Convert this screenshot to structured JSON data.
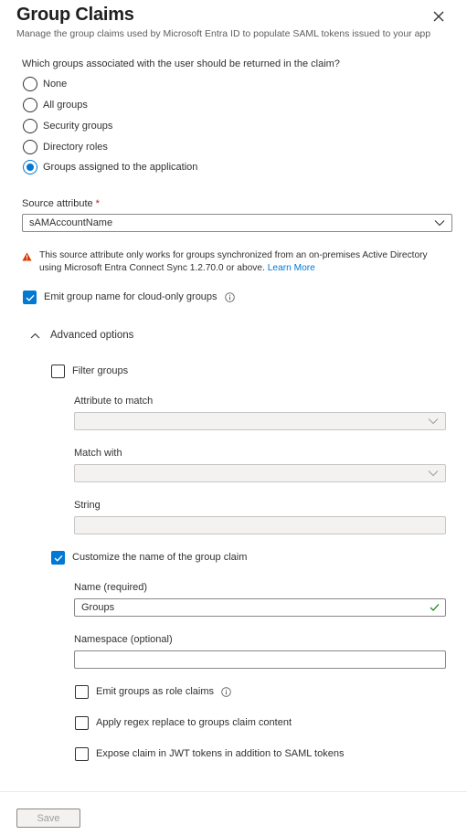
{
  "panel": {
    "title": "Group Claims",
    "subtitle": "Manage the group claims used by Microsoft Entra ID to populate SAML tokens issued to your app"
  },
  "question": "Which groups associated with the user should be returned in the claim?",
  "radio_options": [
    {
      "label": "None",
      "selected": false
    },
    {
      "label": "All groups",
      "selected": false
    },
    {
      "label": "Security groups",
      "selected": false
    },
    {
      "label": "Directory roles",
      "selected": false
    },
    {
      "label": "Groups assigned to the application",
      "selected": true
    }
  ],
  "source_attribute": {
    "label": "Source attribute",
    "required_marker": "*",
    "value": "sAMAccountName"
  },
  "warning": {
    "text": "This source attribute only works for groups synchronized from an on-premises Active Directory using Microsoft Entra Connect Sync 1.2.70.0 or above.",
    "link": "Learn More"
  },
  "emit_cloud_only": {
    "label": "Emit group name for cloud-only groups",
    "checked": true
  },
  "advanced": {
    "label": "Advanced options",
    "filter_groups": {
      "label": "Filter groups",
      "checked": false
    },
    "attribute_to_match": {
      "label": "Attribute to match",
      "value": ""
    },
    "match_with": {
      "label": "Match with",
      "value": ""
    },
    "string": {
      "label": "String",
      "value": ""
    },
    "customize_name": {
      "label": "Customize the name of the group claim",
      "checked": true
    },
    "name": {
      "label": "Name (required)",
      "value": "Groups"
    },
    "namespace": {
      "label": "Namespace (optional)",
      "value": ""
    },
    "emit_role_claims": {
      "label": "Emit groups as role claims",
      "checked": false
    },
    "regex_replace": {
      "label": "Apply regex replace to groups claim content",
      "checked": false
    },
    "expose_jwt": {
      "label": "Expose claim in JWT tokens in addition to SAML tokens",
      "checked": false
    }
  },
  "footer": {
    "save_label": "Save"
  },
  "colors": {
    "accent": "#0078d4",
    "warning": "#d83b01",
    "success": "#107c10",
    "required": "#a4262c"
  },
  "icons": {
    "close": "close-icon",
    "chevron": "chevron-down-icon",
    "warning": "warning-icon",
    "info": "info-icon",
    "check": "checkmark-icon"
  }
}
